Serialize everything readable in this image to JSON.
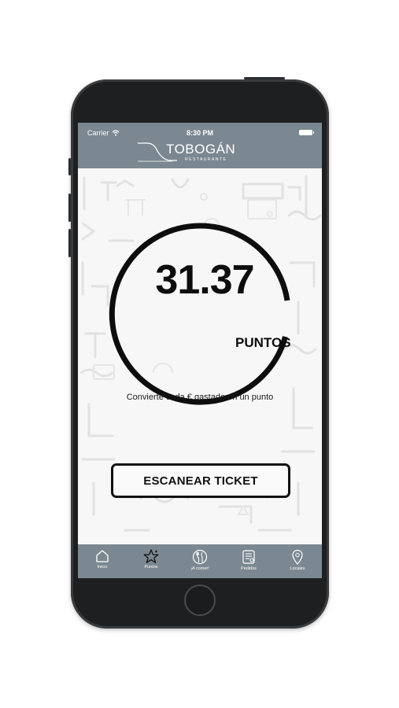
{
  "status_bar": {
    "carrier": "Carrier",
    "time": "8:30 PM"
  },
  "header": {
    "logo_name": "TOBOGÁN",
    "logo_subtitle": "RESTAURANTE"
  },
  "points": {
    "value": "31.37",
    "unit_label": "PUNTOS",
    "hint": "Convierte cada € gastado en un punto"
  },
  "actions": {
    "scan_label": "ESCANEAR TICKET"
  },
  "tabbar": {
    "items": [
      {
        "label": "Inicio",
        "icon": "home-icon"
      },
      {
        "label": "Puntos",
        "icon": "star-icon"
      },
      {
        "label": "¡A comer!",
        "icon": "cutlery-icon"
      },
      {
        "label": "Pedidos",
        "icon": "order-list-icon"
      },
      {
        "label": "Locales",
        "icon": "location-pin-icon"
      }
    ]
  },
  "colors": {
    "header_bg": "#7b8891",
    "ring": "#0d0d0d",
    "screen_bg": "#f7f7f7",
    "pattern": "#e3e3e3"
  }
}
